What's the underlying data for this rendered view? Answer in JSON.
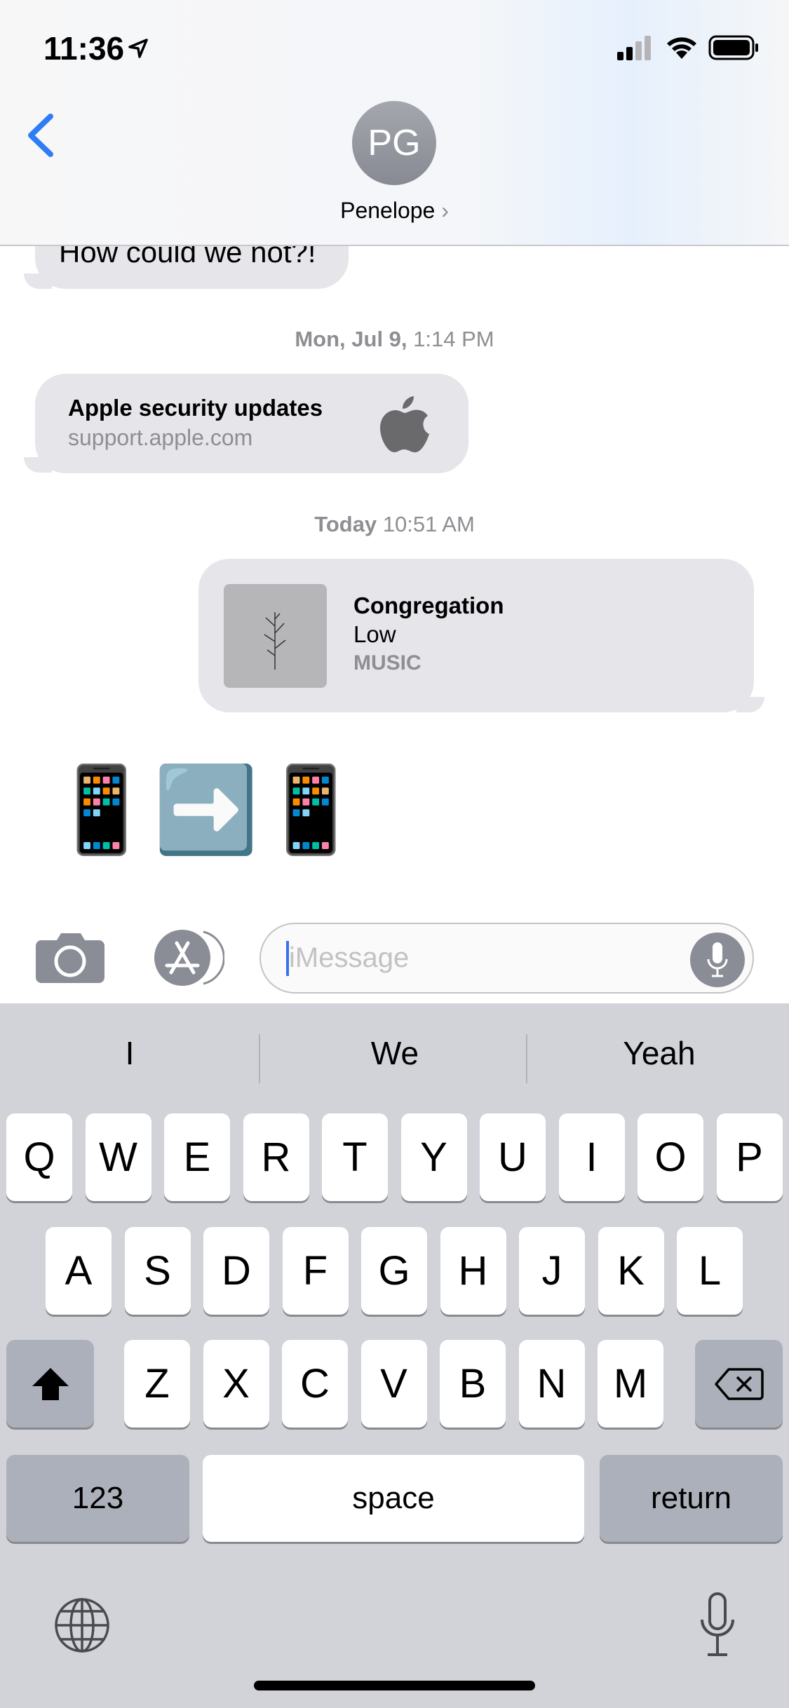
{
  "status_bar": {
    "time": "11:36",
    "icons": [
      "location-arrow-icon",
      "cellular-signal-icon",
      "wifi-icon",
      "battery-icon"
    ]
  },
  "header": {
    "avatar_initials": "PG",
    "contact_name": "Penelope",
    "back_icon": "chevron-left-icon"
  },
  "messages": [
    {
      "type": "text",
      "direction": "incoming",
      "text": "How could we not?!"
    },
    {
      "type": "timestamp",
      "day": "Mon, Jul 9,",
      "time": "1:14 PM"
    },
    {
      "type": "link",
      "direction": "incoming",
      "title": "Apple security updates",
      "domain": "support.apple.com",
      "icon": "apple-logo-icon"
    },
    {
      "type": "timestamp",
      "day": "Today",
      "time": "10:51 AM"
    },
    {
      "type": "music",
      "direction": "outgoing",
      "title": "Congregation",
      "artist": "Low",
      "service": "MUSIC"
    },
    {
      "type": "emoji",
      "direction": "incoming",
      "text": "📱➡️📱"
    }
  ],
  "composer": {
    "placeholder": "iMessage",
    "icons": [
      "camera-icon",
      "app-store-icon",
      "microphone-icon"
    ]
  },
  "keyboard": {
    "suggestions": [
      "I",
      "We",
      "Yeah"
    ],
    "row1": [
      "Q",
      "W",
      "E",
      "R",
      "T",
      "Y",
      "U",
      "I",
      "O",
      "P"
    ],
    "row2": [
      "A",
      "S",
      "D",
      "F",
      "G",
      "H",
      "J",
      "K",
      "L"
    ],
    "row3": [
      "Z",
      "X",
      "C",
      "V",
      "B",
      "N",
      "M"
    ],
    "numbers": "123",
    "space": "space",
    "return": "return"
  }
}
